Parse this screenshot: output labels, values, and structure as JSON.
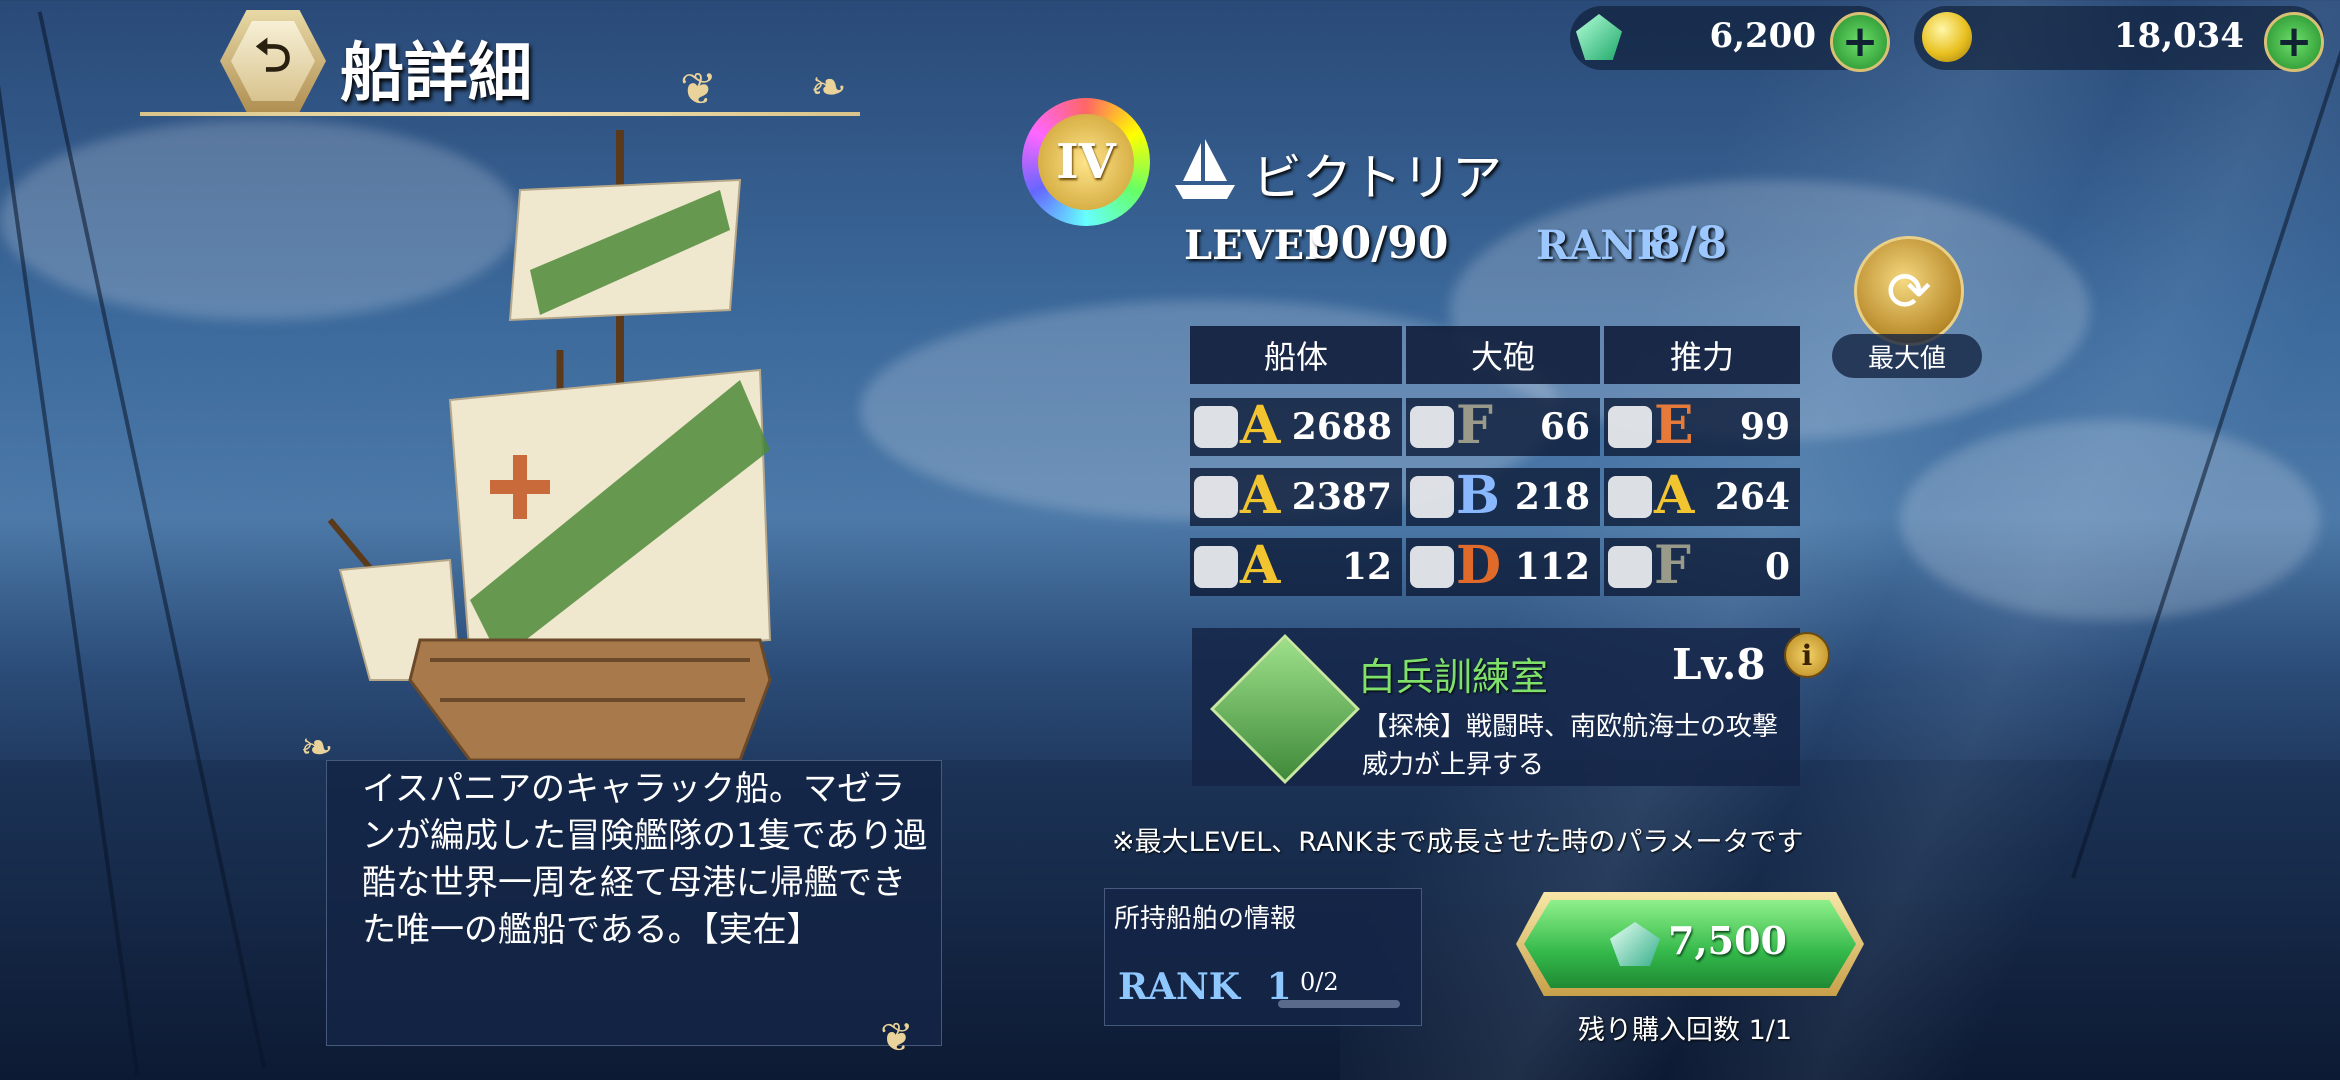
{
  "header": {
    "back_icon": "return-arrow-icon",
    "back_glyph": "⮌",
    "title": "船詳細"
  },
  "currency": {
    "gems": {
      "icon": "emerald-gem-icon",
      "value": "6,200",
      "add_label": "+"
    },
    "coins": {
      "icon": "gold-coin-icon",
      "value": "18,034",
      "add_label": "+"
    }
  },
  "ship": {
    "grade_badge": "IV",
    "type_icon": "ship-type-icon",
    "name": "ビクトリア",
    "level_label": "LEVEL",
    "level_value": "90/90",
    "rank_label": "RANK",
    "rank_value": "8/8",
    "level_color": "#ffffff",
    "rank_color": "#9cc8ff"
  },
  "max_toggle": {
    "icon": "refresh-icon",
    "glyph": "⟳",
    "label": "最大値"
  },
  "stats": {
    "headers": [
      "船体",
      "大砲",
      "推力"
    ],
    "rows": [
      [
        {
          "icon": "supplies-icon",
          "grade": "A",
          "value": "2688"
        },
        {
          "icon": "cannon-icon",
          "grade": "F",
          "value": "66"
        },
        {
          "icon": "sail-icon",
          "grade": "E",
          "value": "99"
        }
      ],
      [
        {
          "icon": "armor-shield-icon",
          "grade": "A",
          "value": "2387"
        },
        {
          "icon": "cannon-range-icon",
          "grade": "B",
          "value": "218"
        },
        {
          "icon": "bell-icon",
          "grade": "A",
          "value": "264"
        }
      ],
      [
        {
          "icon": "barrel-icon",
          "grade": "A",
          "value": "12"
        },
        {
          "icon": "cannon-power-icon",
          "grade": "D",
          "value": "112"
        },
        {
          "icon": "oar-icon",
          "grade": "F",
          "value": "0"
        }
      ]
    ],
    "grade_colors": {
      "A": "#f2c530",
      "B": "#8ab8ff",
      "D": "#e06a2a",
      "E": "#e67a3a",
      "F": "#9a9a8a"
    }
  },
  "skill": {
    "icon": "sword-slash-icon",
    "name": "白兵訓練室",
    "level": "Lv.8",
    "info_icon": "info-icon",
    "info_glyph": "i",
    "description": "【探検】戦闘時、南欧航海士の攻撃威力が上昇する"
  },
  "note": "※最大LEVEL、RANKまで成長させた時のパラメータです",
  "owned": {
    "title": "所持船舶の情報",
    "rank_label": "RANK",
    "rank_value": "1",
    "progress": "0/2",
    "progress_fraction": 0
  },
  "purchase": {
    "gem_icon": "emerald-gem-icon",
    "price": "7,500",
    "remaining": "残り購入回数 1/1"
  },
  "description": "イスパニアのキャラック船。マゼランが編成した冒険艦隊の1隻であり過酷な世界一周を経て母港に帰艦できた唯一の艦船である。【実在】"
}
